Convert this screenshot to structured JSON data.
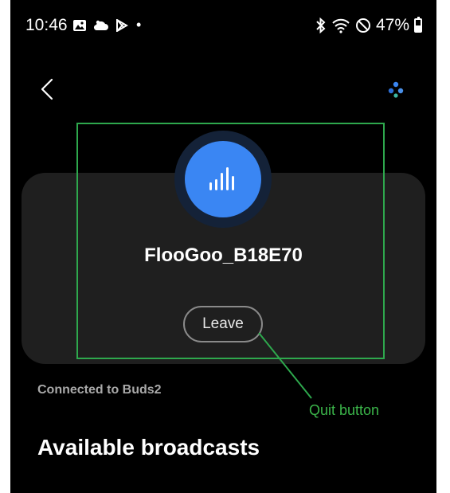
{
  "status_bar": {
    "time": "10:46",
    "dot": "•",
    "battery_percent": "47%",
    "battery_level": 0.47,
    "left_icons": [
      "gallery-icon",
      "cloud-icon",
      "play-store-icon"
    ],
    "right_icons": [
      "bluetooth-icon",
      "wifi-icon",
      "do-not-disturb-icon",
      "battery-icon"
    ]
  },
  "nav": {
    "back_icon": "chevron-left-icon",
    "menu_icon": "dots-menu-icon"
  },
  "broadcast_card": {
    "device_name": "FlooGoo_B18E70",
    "leave_label": "Leave",
    "avatar_icon": "audio-bars-icon",
    "avatar_color": "#3a86f3"
  },
  "connected_label": "Connected to Buds2",
  "section_heading": "Available broadcasts",
  "annotation": {
    "label": "Quit button",
    "color": "#2ea84d"
  }
}
